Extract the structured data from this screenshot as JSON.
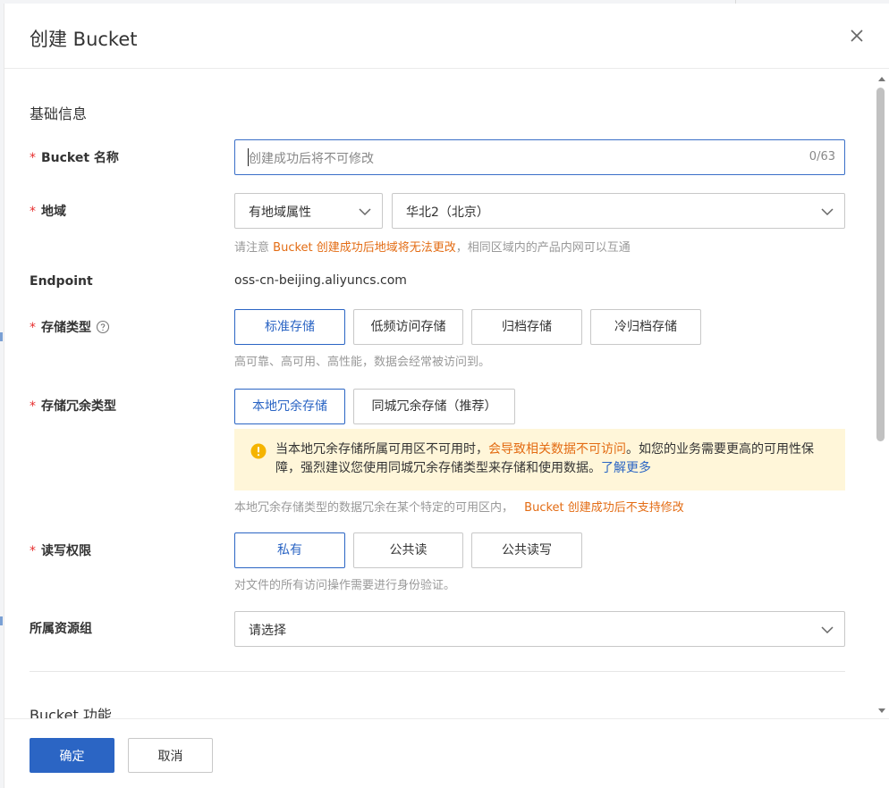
{
  "dialog": {
    "title": "创建 Bucket"
  },
  "basic": {
    "section_title": "基础信息",
    "name": {
      "label": "Bucket 名称",
      "placeholder": "创建成功后将不可修改",
      "counter": "0/63"
    },
    "region": {
      "label": "地域",
      "attr_select": "有地域属性",
      "region_select": "华北2（北京）",
      "hint_prefix": "请注意",
      "hint_warn": "Bucket 创建成功后地域将无法更改",
      "hint_suffix": "，相同区域内的产品内网可以互通"
    },
    "endpoint": {
      "label": "Endpoint",
      "value": "oss-cn-beijing.aliyuncs.com"
    },
    "storage_class": {
      "label": "存储类型",
      "options": [
        "标准存储",
        "低频访问存储",
        "归档存储",
        "冷归档存储"
      ],
      "selected": "标准存储",
      "hint": "高可靠、高可用、高性能，数据会经常被访问到。"
    },
    "redundancy": {
      "label": "存储冗余类型",
      "options": [
        "本地冗余存储",
        "同城冗余存储（推荐）"
      ],
      "selected": "本地冗余存储",
      "notice_part1": "当本地冗余存储所属可用区不可用时，",
      "notice_highlight": "会导致相关数据不可访问",
      "notice_part2": "。如您的业务需要更高的可用性保障，强烈建议您使用同城冗余存储类型来存储和使用数据。",
      "notice_link": "了解更多",
      "hint": "本地冗余存储类型的数据冗余在某个特定的可用区内，",
      "hint_warn": "Bucket 创建成功后不支持修改"
    },
    "acl": {
      "label": "读写权限",
      "options": [
        "私有",
        "公共读",
        "公共读写"
      ],
      "selected": "私有",
      "hint": "对文件的所有访问操作需要进行身份验证。"
    },
    "resource_group": {
      "label": "所属资源组",
      "placeholder": "请选择"
    }
  },
  "features": {
    "section_title": "Bucket 功能"
  },
  "footer": {
    "ok_label": "确定",
    "cancel_label": "取消"
  },
  "colors": {
    "primary": "#2b65c4",
    "warning": "#e36c14",
    "required": "#e62e2e",
    "notice_bg": "#fff6d9"
  }
}
